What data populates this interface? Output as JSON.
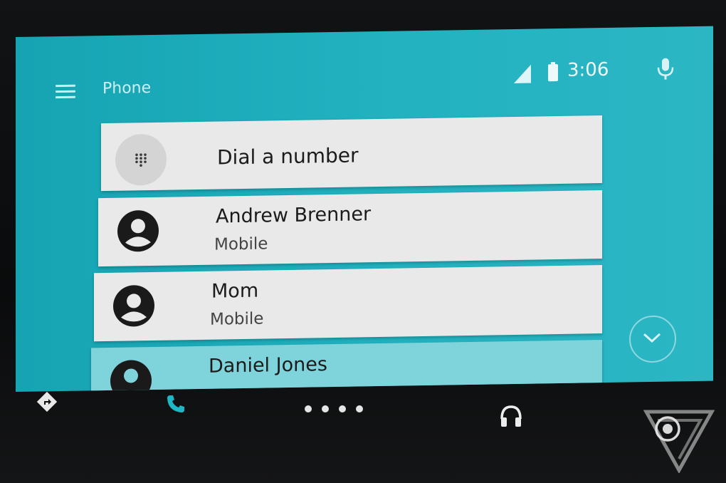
{
  "header": {
    "title": "Phone",
    "time": "3:06"
  },
  "dial": {
    "label": "Dial a number"
  },
  "contacts": [
    {
      "name": "Andrew Brenner",
      "type": "Mobile"
    },
    {
      "name": "Mom",
      "type": "Mobile"
    },
    {
      "name": "Daniel Jones",
      "type": ""
    }
  ],
  "icons": {
    "menu": "hamburger-menu-icon",
    "signal": "signal-icon",
    "battery": "battery-icon",
    "mic": "microphone-icon",
    "dialpad": "dialpad-icon",
    "avatar": "person-icon",
    "scroll": "chevron-down-icon",
    "nav": "navigation-icon",
    "phone": "phone-icon",
    "home": "home-dots-icon",
    "audio": "headphones-icon",
    "recents": "recents-icon"
  },
  "colors": {
    "accent_teal": "#22b2c0",
    "card": "#e9e9e9",
    "highlight_card": "#7fd3da",
    "active_nav": "#1fb7c6"
  }
}
